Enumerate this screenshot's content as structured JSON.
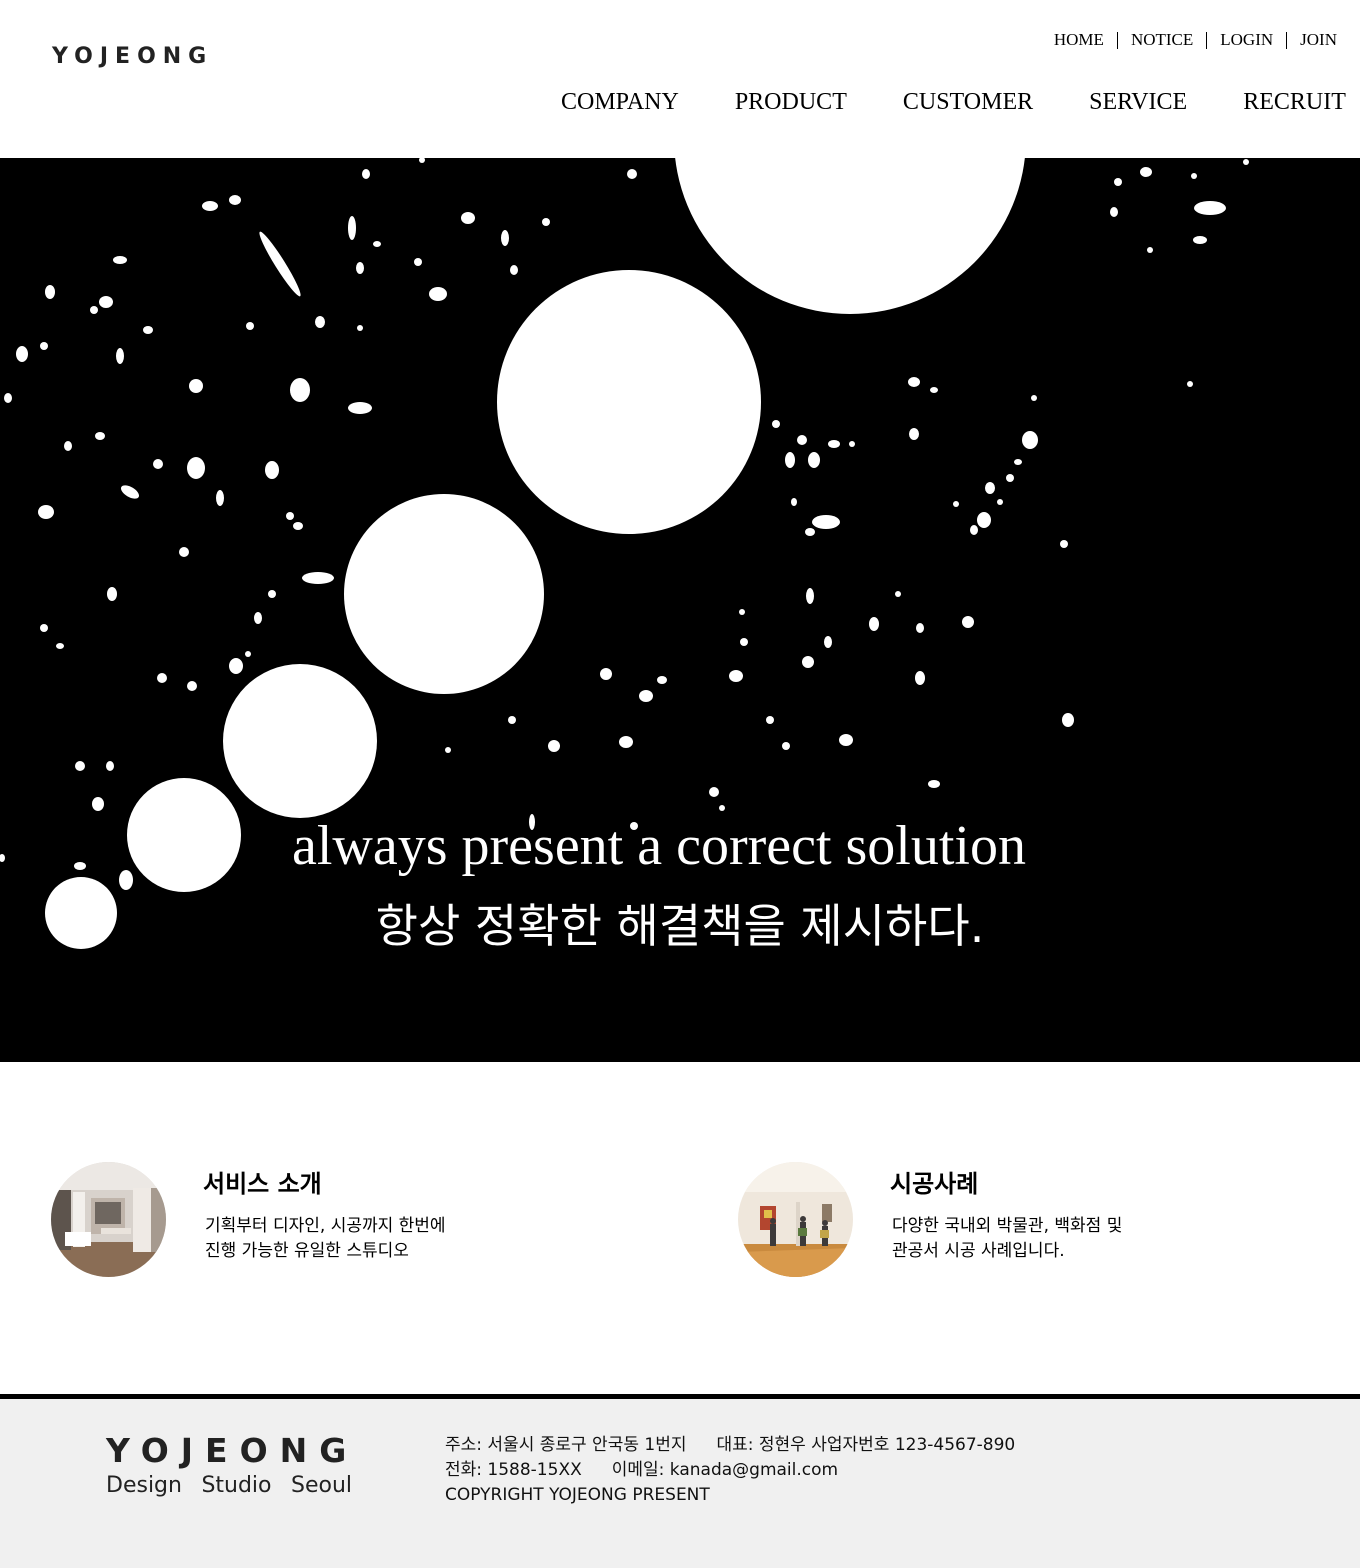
{
  "header": {
    "logo": "YOJEONG",
    "util_nav": [
      "HOME",
      "NOTICE",
      "LOGIN",
      "JOIN"
    ],
    "main_nav": [
      "COMPANY",
      "PRODUCT",
      "CUSTOMER",
      "SERVICE",
      "RECRUIT"
    ]
  },
  "hero": {
    "headline_en": "always present a correct solution",
    "headline_ko": "항상 정확한 해결책을 제시하다."
  },
  "features": [
    {
      "title": "서비스 소개",
      "desc_line1": "기획부터 디자인, 시공까지 한번에",
      "desc_line2": "진행 가능한 유일한 스튜디오",
      "thumbnail": "studio-interior-photo"
    },
    {
      "title": "시공사례",
      "desc_line1": "다양한 국내외 박물관, 백화점 및",
      "desc_line2": "관공서 시공 사례입니다.",
      "thumbnail": "gallery-visitors-photo"
    }
  ],
  "footer": {
    "logo": "YOJEONG",
    "tagline": [
      "Design",
      "Studio",
      "Seoul"
    ],
    "address": "주소: 서울시 종로구 안국동 1번지",
    "ceo": "대표: 정현우 사업자번호 123-4567-890",
    "phone": "전화: 1588-15XX",
    "email": "이메일: kanada@gmail.com",
    "copyright": "COPYRIGHT YOJEONG PRESENT"
  },
  "colors": {
    "background": "#ffffff",
    "hero_background": "#000000",
    "footer_background": "#f0f0f0",
    "text": "#000000"
  }
}
